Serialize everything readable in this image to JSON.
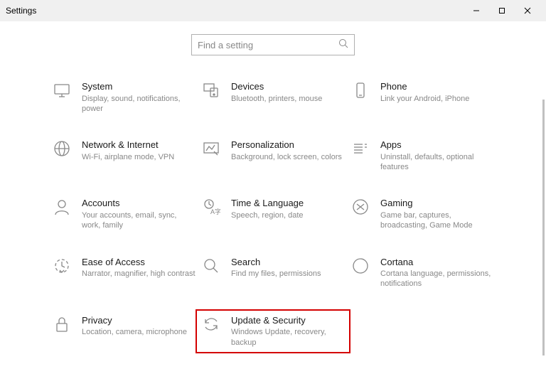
{
  "window": {
    "title": "Settings"
  },
  "search": {
    "placeholder": "Find a setting"
  },
  "categories": [
    {
      "id": "system",
      "title": "System",
      "desc": "Display, sound, notifications, power"
    },
    {
      "id": "devices",
      "title": "Devices",
      "desc": "Bluetooth, printers, mouse"
    },
    {
      "id": "phone",
      "title": "Phone",
      "desc": "Link your Android, iPhone"
    },
    {
      "id": "network",
      "title": "Network & Internet",
      "desc": "Wi-Fi, airplane mode, VPN"
    },
    {
      "id": "personalization",
      "title": "Personalization",
      "desc": "Background, lock screen, colors"
    },
    {
      "id": "apps",
      "title": "Apps",
      "desc": "Uninstall, defaults, optional features"
    },
    {
      "id": "accounts",
      "title": "Accounts",
      "desc": "Your accounts, email, sync, work, family"
    },
    {
      "id": "time-language",
      "title": "Time & Language",
      "desc": "Speech, region, date"
    },
    {
      "id": "gaming",
      "title": "Gaming",
      "desc": "Game bar, captures, broadcasting, Game Mode"
    },
    {
      "id": "ease-of-access",
      "title": "Ease of Access",
      "desc": "Narrator, magnifier, high contrast"
    },
    {
      "id": "search",
      "title": "Search",
      "desc": "Find my files, permissions"
    },
    {
      "id": "cortana",
      "title": "Cortana",
      "desc": "Cortana language, permissions, notifications"
    },
    {
      "id": "privacy",
      "title": "Privacy",
      "desc": "Location, camera, microphone"
    },
    {
      "id": "update-security",
      "title": "Update & Security",
      "desc": "Windows Update, recovery, backup",
      "highlighted": true
    }
  ]
}
